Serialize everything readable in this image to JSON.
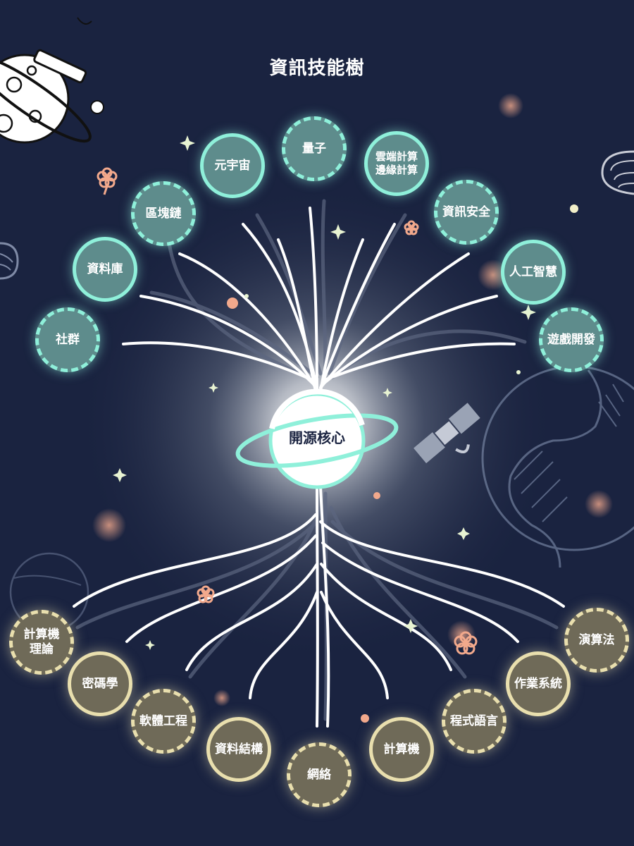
{
  "title": "資訊技能樹",
  "core": "開源核心",
  "colors": {
    "background": "#1a2340",
    "branch_fill": "#5e8c8c",
    "branch_border": "#8ff0da",
    "root_fill": "#6f6a58",
    "root_border": "#e9dfae",
    "core_fill": "#ffffff"
  },
  "branches": [
    {
      "label": "社群"
    },
    {
      "label": "資料庫"
    },
    {
      "label": "區塊鏈"
    },
    {
      "label": "元宇宙"
    },
    {
      "label": "量子"
    },
    {
      "label": "雲端計算\n邊緣計算"
    },
    {
      "label": "資訊安全"
    },
    {
      "label": "人工智慧"
    },
    {
      "label": "遊戲開發"
    }
  ],
  "roots": [
    {
      "label": "計算機\n理論"
    },
    {
      "label": "密碼學"
    },
    {
      "label": "軟體工程"
    },
    {
      "label": "資料結構"
    },
    {
      "label": "網絡"
    },
    {
      "label": "計算機"
    },
    {
      "label": "程式語言"
    },
    {
      "label": "作業系統"
    },
    {
      "label": "演算法"
    }
  ],
  "decorations": [
    "moon-telescope-icon",
    "satellite-icon",
    "earth-globe-icon",
    "flower-icon",
    "sparkle-icon"
  ]
}
